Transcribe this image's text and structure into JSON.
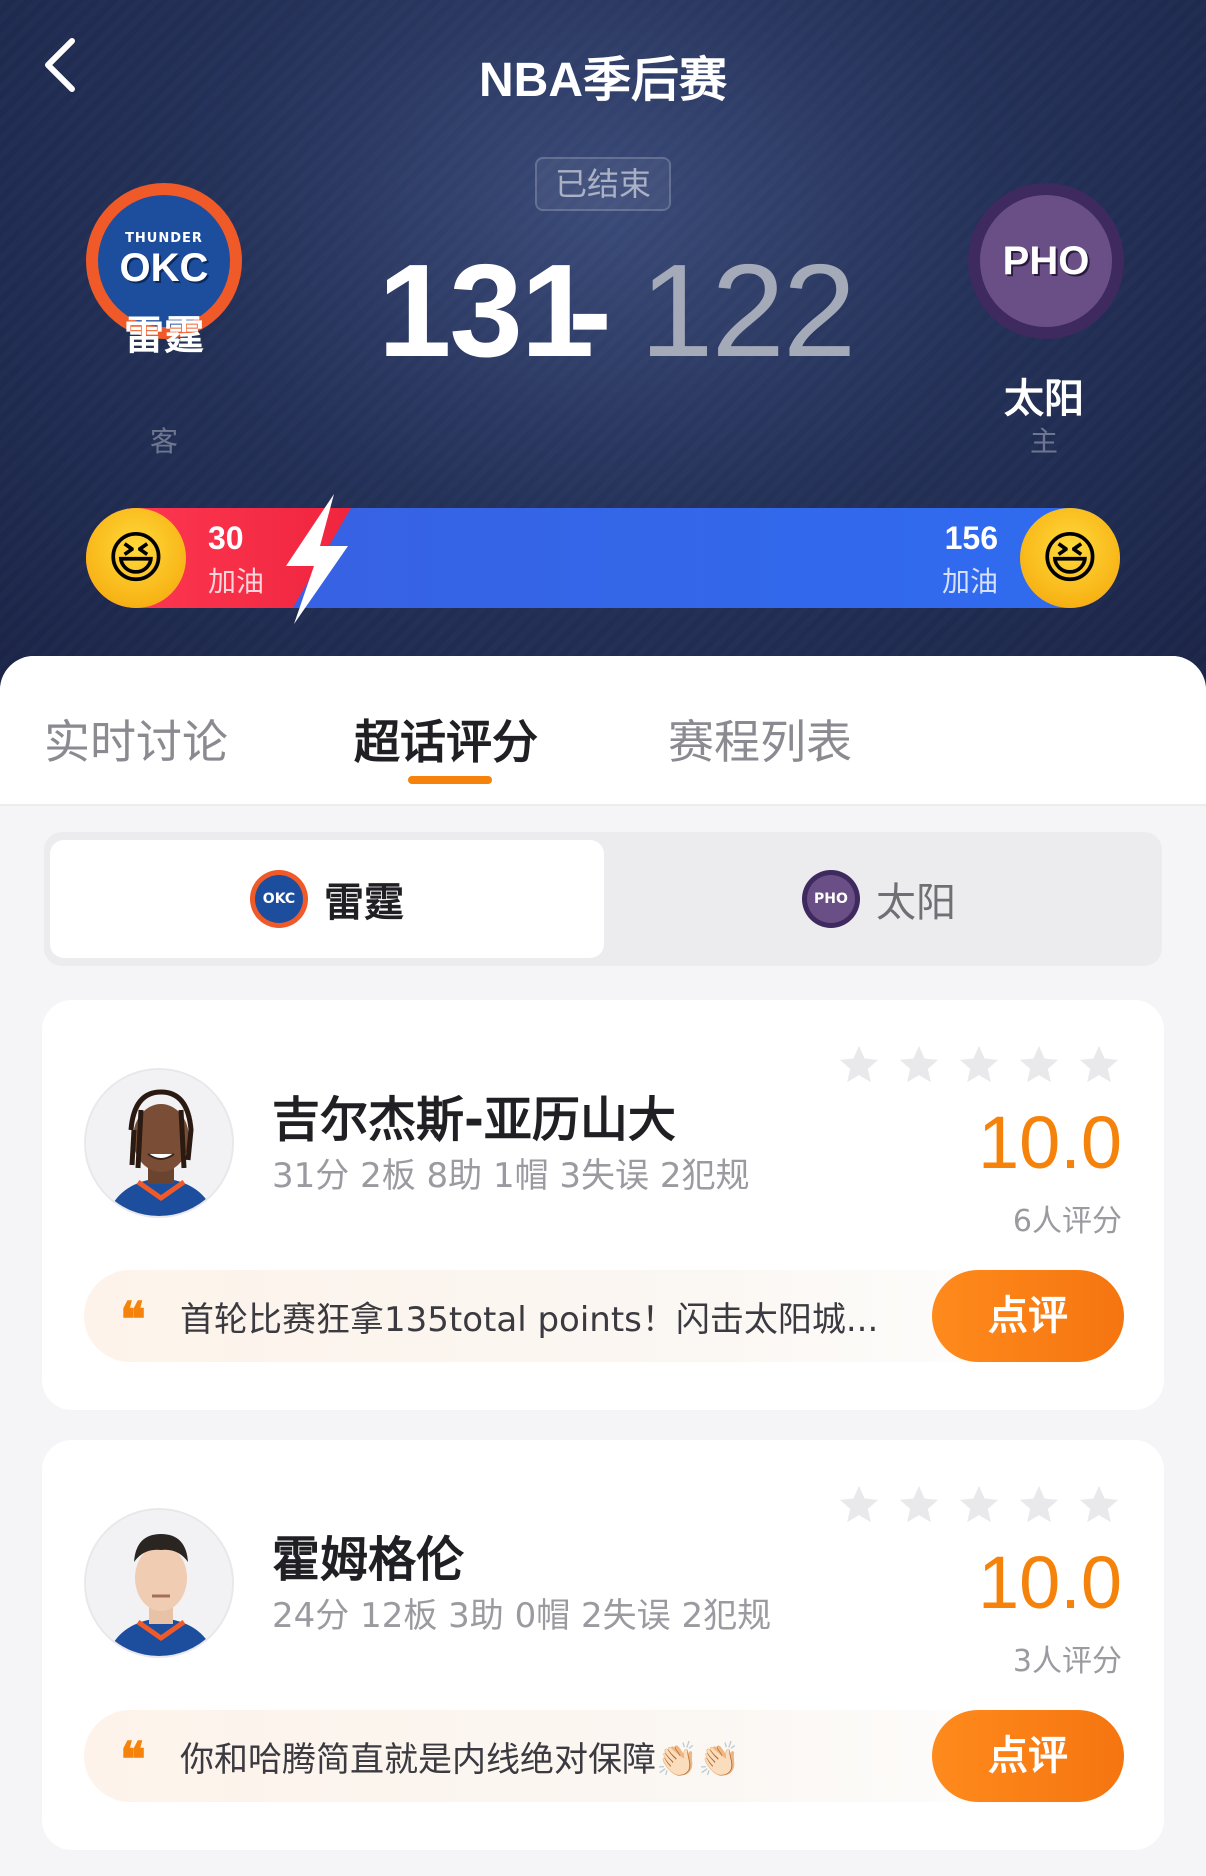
{
  "header": {
    "title": "NBA季后赛",
    "status": "已结束"
  },
  "match": {
    "away": {
      "name": "雷霆",
      "role": "客",
      "logo_top": "THUNDER",
      "logo_main": "OKC",
      "score": "131"
    },
    "home": {
      "name": "太阳",
      "role": "主",
      "logo_top": "",
      "logo_main": "PHO",
      "score": "122"
    },
    "dash": "-"
  },
  "cheer": {
    "left_count": "30",
    "left_label": "加油",
    "right_count": "156",
    "right_label": "加油"
  },
  "tabs": [
    {
      "label": "实时讨论"
    },
    {
      "label": "超话评分"
    },
    {
      "label": "赛程列表"
    }
  ],
  "segment": {
    "left": {
      "label": "雷霆",
      "logo": "OKC"
    },
    "right": {
      "label": "太阳",
      "logo": "PHO"
    }
  },
  "players": [
    {
      "name": "吉尔杰斯-亚历山大",
      "stats": "31分 2板 8助 1帽 3失误 2犯规",
      "rating": "10.0",
      "rating_count": "6人评分",
      "comment": "首轮比赛狂拿135total points！闪击太阳城...",
      "review_label": "点评"
    },
    {
      "name": "霍姆格伦",
      "stats": "24分 12板 3助 0帽 2失误 2犯规",
      "rating": "10.0",
      "rating_count": "3人评分",
      "comment": "你和哈腾简直就是内线绝对保障👏🏻👏🏻",
      "review_label": "点评"
    }
  ],
  "colors": {
    "accent": "#f5820a",
    "hero_bg": "#243158",
    "cheer_red": "#f0253e",
    "cheer_blue": "#2f6cf0"
  },
  "icons": {
    "back": "chevron-left-icon",
    "quote": "quote-icon",
    "star": "star-icon",
    "bolt": "lightning-bolt-icon"
  }
}
